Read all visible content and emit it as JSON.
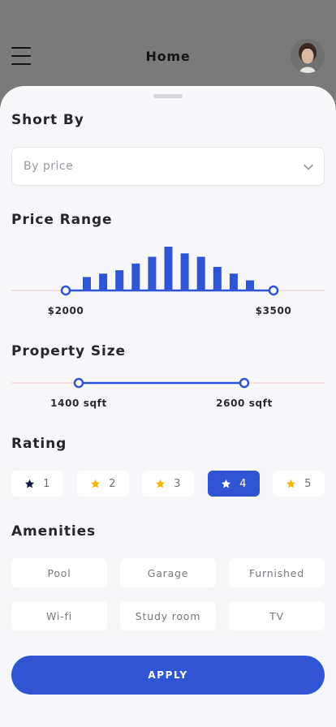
{
  "header": {
    "title": "Home",
    "menu_icon": "hamburger-menu-icon",
    "avatar": "user-avatar"
  },
  "sort": {
    "title": "Short By",
    "selected": "By price",
    "icon": "chevron-down-icon"
  },
  "price_range": {
    "title": "Price Range",
    "min_label": "$2000",
    "max_label": "$3500"
  },
  "property_size": {
    "title": "Property Size",
    "min_label": "1400 sqft",
    "max_label": "2600 sqft"
  },
  "rating": {
    "title": "Rating",
    "options": [
      {
        "label": "1",
        "star_color": "#0d1a4a"
      },
      {
        "label": "2",
        "star_color": "#f2b705"
      },
      {
        "label": "3",
        "star_color": "#f2b705"
      },
      {
        "label": "4",
        "star_color": "#ffffff"
      },
      {
        "label": "5",
        "star_color": "#f2b705"
      }
    ],
    "selected": "4"
  },
  "amenities": {
    "title": "Amenities",
    "items": [
      "Pool",
      "Garage",
      "Furnished",
      "Wi-fi",
      "Study room",
      "TV"
    ]
  },
  "apply_label": "APPLY",
  "colors": {
    "accent": "#2f55d4",
    "sheet_bg": "#f7f7f9",
    "overlay": "#7a7a7a",
    "star_gold": "#f2b705"
  },
  "chart_data": {
    "type": "bar",
    "title": "",
    "values": [
      4,
      5,
      6,
      8,
      10,
      13,
      11,
      10,
      7,
      5,
      3
    ],
    "ylim": [
      0,
      13
    ]
  }
}
